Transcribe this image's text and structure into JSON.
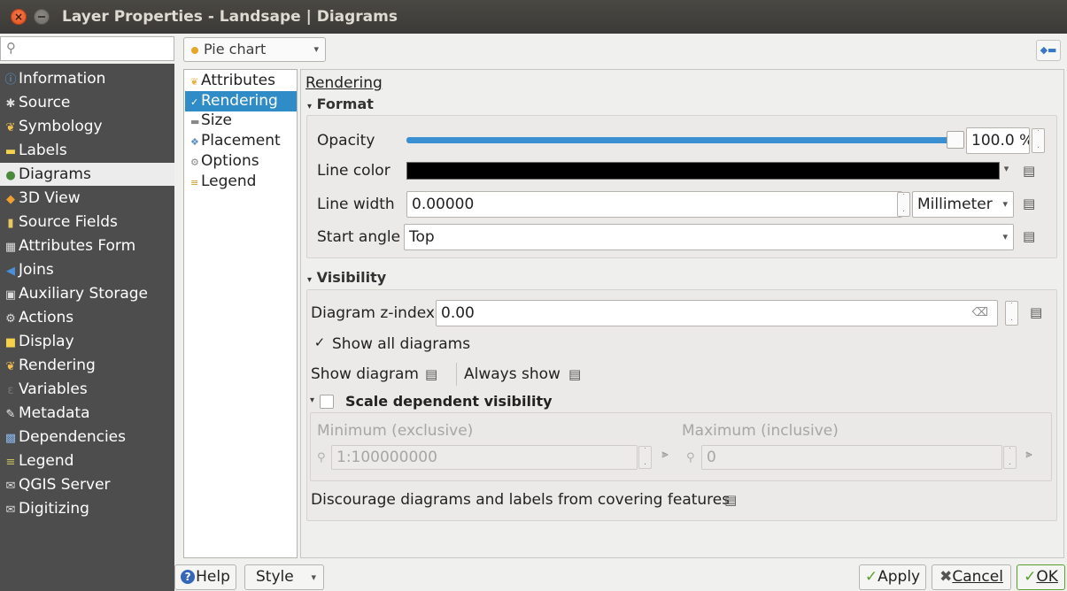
{
  "window": {
    "title": "Layer Properties - Landsape | Diagrams"
  },
  "search": {
    "placeholder": ""
  },
  "sidebar": {
    "items": [
      {
        "label": "Information",
        "icon": "info-icon"
      },
      {
        "label": "Source",
        "icon": "source-icon"
      },
      {
        "label": "Symbology",
        "icon": "symbology-icon"
      },
      {
        "label": "Labels",
        "icon": "labels-icon"
      },
      {
        "label": "Diagrams",
        "icon": "diagrams-icon"
      },
      {
        "label": "3D View",
        "icon": "cube-icon"
      },
      {
        "label": "Source Fields",
        "icon": "fields-icon"
      },
      {
        "label": "Attributes Form",
        "icon": "form-icon"
      },
      {
        "label": "Joins",
        "icon": "joins-icon"
      },
      {
        "label": "Auxiliary Storage",
        "icon": "storage-icon"
      },
      {
        "label": "Actions",
        "icon": "actions-icon"
      },
      {
        "label": "Display",
        "icon": "display-icon"
      },
      {
        "label": "Rendering",
        "icon": "rendering-icon"
      },
      {
        "label": "Variables",
        "icon": "variables-icon"
      },
      {
        "label": "Metadata",
        "icon": "metadata-icon"
      },
      {
        "label": "Dependencies",
        "icon": "dependencies-icon"
      },
      {
        "label": "Legend",
        "icon": "legend-icon"
      },
      {
        "label": "QGIS Server",
        "icon": "server-icon"
      },
      {
        "label": "Digitizing",
        "icon": "digitizing-icon"
      }
    ],
    "selected": "Diagrams"
  },
  "diagram_type": {
    "value": "Pie chart"
  },
  "sublist": {
    "items": [
      "Attributes",
      "Rendering",
      "Size",
      "Placement",
      "Options",
      "Legend"
    ],
    "selected": "Rendering"
  },
  "panel": {
    "section_title": "Rendering",
    "format": {
      "header": "Format",
      "opacity_label": "Opacity",
      "opacity_value": "100.0 %",
      "opacity_fraction": 1.0,
      "line_color_label": "Line color",
      "line_color": "#000000",
      "line_width_label": "Line width",
      "line_width_value": "0.00000",
      "line_width_unit": "Millimeter",
      "start_angle_label": "Start angle",
      "start_angle_value": "Top"
    },
    "visibility": {
      "header": "Visibility",
      "zindex_label": "Diagram z-index",
      "zindex_value": "0.00",
      "show_all_label": "Show all diagrams",
      "show_all_checked": true,
      "show_diagram_label": "Show diagram",
      "always_show_label": "Always show",
      "scale_dep_label": "Scale dependent visibility",
      "scale_dep_checked": false,
      "min_label": "Minimum (exclusive)",
      "min_value": "1:100000000",
      "max_label": "Maximum (inclusive)",
      "max_value": "0",
      "discourage_label": "Discourage diagrams and labels from covering features"
    }
  },
  "footer": {
    "help": "Help",
    "style": "Style",
    "apply": "Apply",
    "cancel": "Cancel",
    "ok": "OK"
  },
  "colors": {
    "selection": "#308cc6",
    "sidebar_bg": "#4d4d4d",
    "slider": "#3a8fd0"
  }
}
